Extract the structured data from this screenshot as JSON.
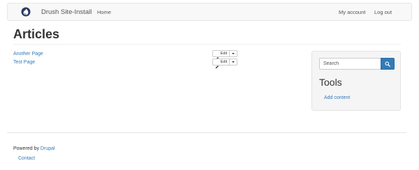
{
  "navbar": {
    "site_name": "Drush Site-Install",
    "home_label": "Home",
    "account_label": "My account",
    "logout_label": "Log out",
    "logo_icon": "drupal-drop-icon"
  },
  "main": {
    "title": "Articles",
    "articles": [
      {
        "label": "Another Page",
        "edit_label": "Edit"
      },
      {
        "label": "Test Page",
        "edit_label": "Edit"
      }
    ]
  },
  "sidebar": {
    "search_placeholder": "Search",
    "search_icon": "search-icon",
    "tools_heading": "Tools",
    "add_content_label": "Add content"
  },
  "footer": {
    "powered_prefix": "Powered by",
    "powered_link": "Drupal",
    "contact_label": "Contact"
  },
  "colors": {
    "link": "#337ab7",
    "navbar_bg": "#f8f8f8",
    "sidebar_bg": "#f5f5f5",
    "primary_button": "#337ab7"
  }
}
